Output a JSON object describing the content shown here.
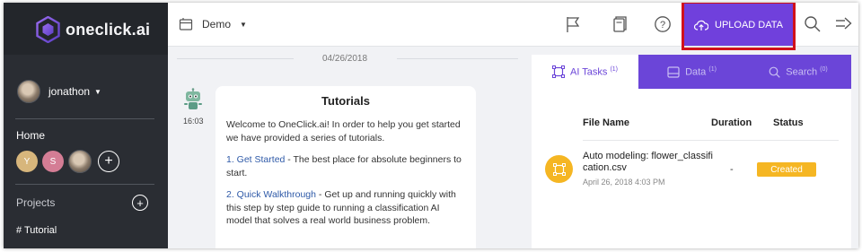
{
  "brand": {
    "name": "oneclick.ai"
  },
  "user": {
    "name": "jonathon"
  },
  "sidebar": {
    "home_label": "Home",
    "home_members": [
      "Y",
      "S"
    ],
    "add_symbol": "+",
    "projects_label": "Projects",
    "projects_add_symbol": "+",
    "project_items": [
      {
        "label": "# Tutorial"
      }
    ]
  },
  "topbar": {
    "workspace": "Demo",
    "upload_label": "UPLOAD DATA"
  },
  "chat": {
    "date": "04/26/2018",
    "time": "16:03",
    "title": "Tutorials",
    "intro": "Welcome to OneClick.ai! In order to help you get started we have provided a series of tutorials.",
    "step1_link": "1. Get Started",
    "step1_text": " - The best place for absolute beginners to start.",
    "step2_link": "2. Quick Walkthrough",
    "step2_text": " - Get up and running quickly with this step by step guide to running a classification AI model that solves a real world business problem."
  },
  "tasks_panel": {
    "tabs": [
      {
        "label": "AI Tasks",
        "count": "(1)"
      },
      {
        "label": "Data",
        "count": "(1)"
      },
      {
        "label": "Search",
        "count": "(0)"
      }
    ],
    "columns": {
      "file_name": "File Name",
      "duration": "Duration",
      "status": "Status"
    },
    "rows": [
      {
        "file_name": "Auto modeling: flower_classification.csv",
        "date": "April 26, 2018 4:03 PM",
        "duration": "-",
        "status": "Created"
      }
    ]
  },
  "colors": {
    "accent": "#6b45d8",
    "sidebar_bg": "#2a2d33",
    "status_created": "#f5b623",
    "highlight_outline": "#d0111b"
  },
  "icons": [
    "logo-mark-icon",
    "caret-down-icon",
    "workspace-icon",
    "flag-icon",
    "documents-icon",
    "help-icon",
    "cloud-upload-icon",
    "search-icon",
    "logout-icon",
    "bot-avatar-icon",
    "ai-task-icon",
    "data-icon",
    "task-file-icon"
  ]
}
